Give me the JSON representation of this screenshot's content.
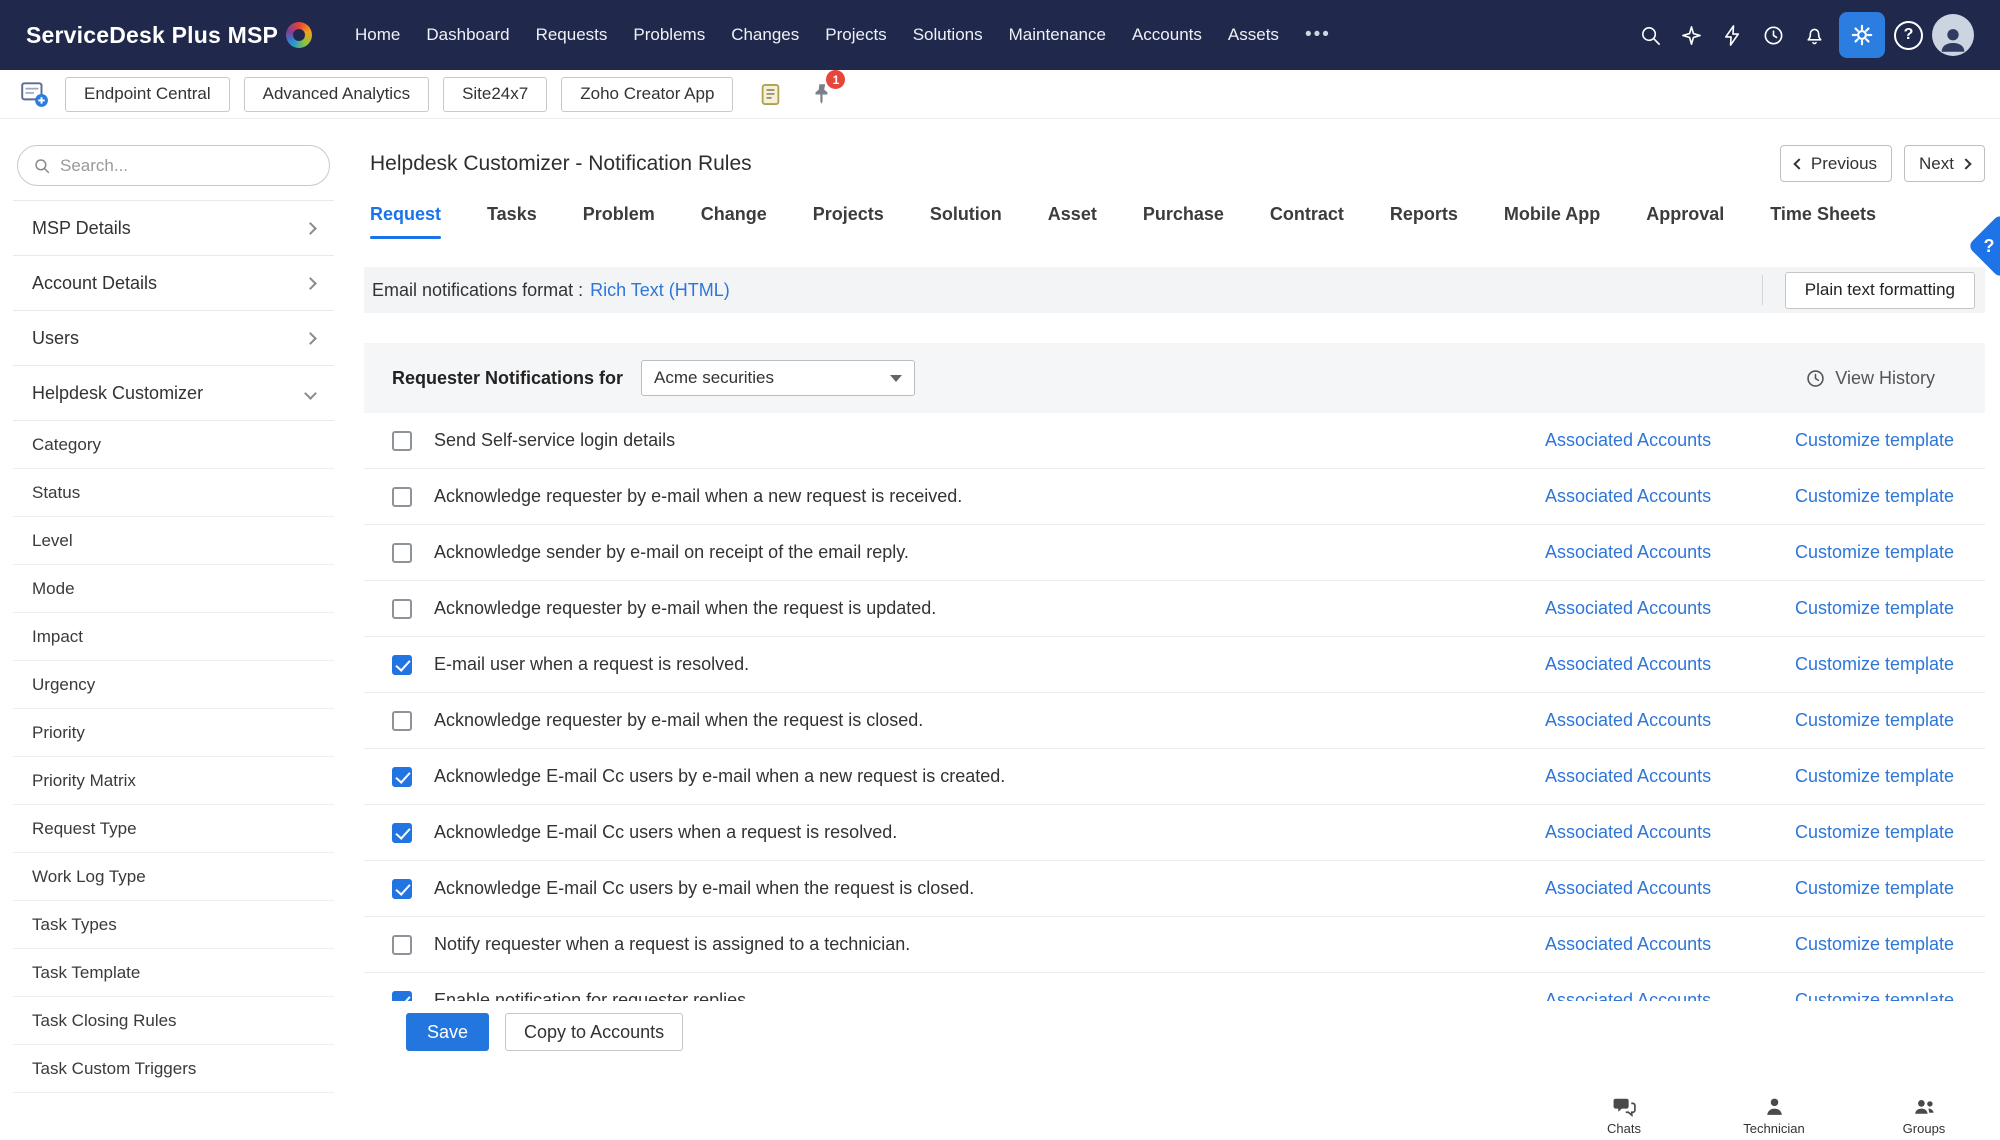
{
  "colors": {
    "navbar_bg": "#20294b",
    "accent_blue": "#1a73e8",
    "gear_button_bg": "#2b7de0",
    "link_blue": "#2d76d9",
    "checkbox_checked": "#2274e0",
    "save_button": "#2276dd",
    "badge_red": "#e8453c",
    "bar_gray": "#f3f4f5"
  },
  "navbar": {
    "logo": "ServiceDesk Plus MSP",
    "items": [
      "Home",
      "Dashboard",
      "Requests",
      "Problems",
      "Changes",
      "Projects",
      "Solutions",
      "Maintenance",
      "Accounts",
      "Assets"
    ],
    "more": "•••",
    "help_glyph": "?"
  },
  "shortcutbar": {
    "buttons": [
      "Endpoint Central",
      "Advanced Analytics",
      "Site24x7",
      "Zoho Creator App"
    ],
    "pin_badge": "1"
  },
  "sidebar": {
    "search_placeholder": "Search...",
    "groups": [
      {
        "label": "MSP Details",
        "expanded": false
      },
      {
        "label": "Account Details",
        "expanded": false
      },
      {
        "label": "Users",
        "expanded": false
      },
      {
        "label": "Helpdesk Customizer",
        "expanded": true
      }
    ],
    "items": [
      "Category",
      "Status",
      "Level",
      "Mode",
      "Impact",
      "Urgency",
      "Priority",
      "Priority Matrix",
      "Request Type",
      "Work Log Type",
      "Task Types",
      "Task Template",
      "Task Closing Rules",
      "Task Custom Triggers"
    ]
  },
  "main": {
    "title": "Helpdesk Customizer - Notification Rules",
    "pager": {
      "previous": "Previous",
      "next": "Next"
    },
    "tabs": [
      {
        "label": "Request",
        "active": true
      },
      {
        "label": "Tasks",
        "active": false
      },
      {
        "label": "Problem",
        "active": false
      },
      {
        "label": "Change",
        "active": false
      },
      {
        "label": "Projects",
        "active": false
      },
      {
        "label": "Solution",
        "active": false
      },
      {
        "label": "Asset",
        "active": false
      },
      {
        "label": "Purchase",
        "active": false
      },
      {
        "label": "Contract",
        "active": false
      },
      {
        "label": "Reports",
        "active": false
      },
      {
        "label": "Mobile App",
        "active": false
      },
      {
        "label": "Approval",
        "active": false
      },
      {
        "label": "Time Sheets",
        "active": false
      }
    ],
    "format_bar": {
      "label": "Email notifications format :",
      "link": "Rich Text (HTML)",
      "button": "Plain text formatting"
    },
    "panel": {
      "header": "Requester Notifications for",
      "dropdown_value": "Acme securities",
      "view_history": "View History",
      "rows": [
        {
          "checked": false,
          "text": "Send Self-service login details"
        },
        {
          "checked": false,
          "text": "Acknowledge requester by e-mail when a new request is received."
        },
        {
          "checked": false,
          "text": "Acknowledge sender by e-mail on receipt of the email reply."
        },
        {
          "checked": false,
          "text": "Acknowledge requester by e-mail when the request is updated."
        },
        {
          "checked": true,
          "text": "E-mail user when a request is resolved."
        },
        {
          "checked": false,
          "text": "Acknowledge requester by e-mail when the request is closed."
        },
        {
          "checked": true,
          "text": "Acknowledge E-mail Cc users by e-mail when a new request is created."
        },
        {
          "checked": true,
          "text": "Acknowledge E-mail Cc users when a request is resolved."
        },
        {
          "checked": true,
          "text": "Acknowledge E-mail Cc users by e-mail when the request is closed."
        },
        {
          "checked": false,
          "text": "Notify requester when a request is assigned to a technician."
        },
        {
          "checked": true,
          "text": "Enable notification for requester replies"
        }
      ],
      "row_links": {
        "accounts": "Associated Accounts",
        "template": "Customize template"
      }
    },
    "footer": {
      "save": "Save",
      "copy": "Copy to Accounts"
    }
  },
  "help_tab": "?",
  "corner": {
    "chats": "Chats",
    "technician": "Technician",
    "groups": "Groups"
  }
}
